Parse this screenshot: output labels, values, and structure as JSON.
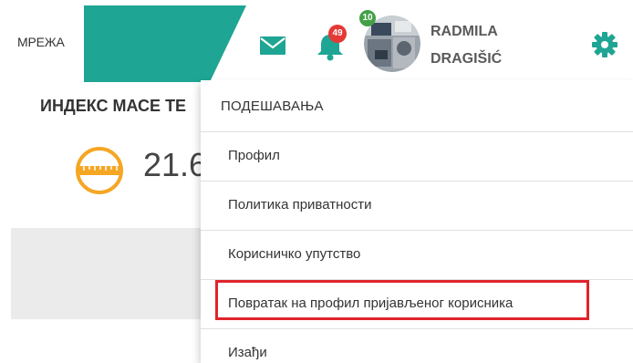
{
  "topbar": {
    "nav_link": "МРЕЖА",
    "mail_icon": "envelope-icon",
    "bell_icon": "bell-icon",
    "notifications_count": "49",
    "avatar_badge_count": "10",
    "user_first_name": "RADMILA",
    "user_last_name": "DRAGIŠIĆ",
    "settings_icon": "gear-icon"
  },
  "bmi_card": {
    "title": "ИНДЕКС МАСЕ ТЕ",
    "value": "21.6",
    "icon": "measuring-tape-icon"
  },
  "dropdown": {
    "header": "ПОДЕШАВАЊА",
    "items": [
      {
        "label": "Профил"
      },
      {
        "label": "Политика приватности"
      },
      {
        "label": "Корисничко упутство"
      },
      {
        "label": "Повратак на профил пријављеног корисника"
      },
      {
        "label": "Изађи"
      }
    ]
  },
  "colors": {
    "teal": "#1fa593",
    "badge_red": "#e53935",
    "badge_green": "#43a047",
    "highlight_red": "#e0242b",
    "tape_orange": "#f5a623"
  }
}
